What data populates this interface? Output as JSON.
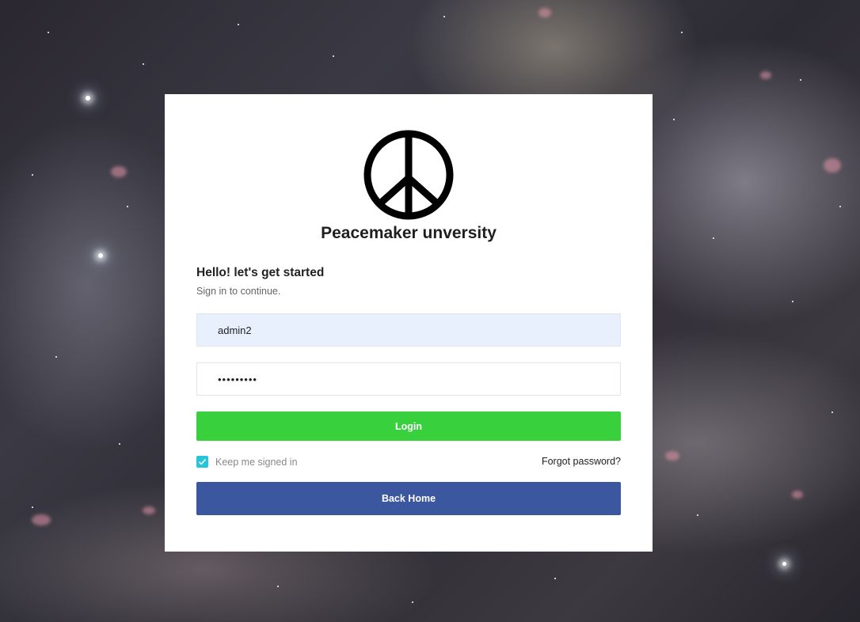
{
  "brand": {
    "name": "Peacemaker unversity",
    "logo_icon": "peace-sign-icon"
  },
  "form": {
    "heading": "Hello! let's get started",
    "subheading": "Sign in to continue.",
    "username_value": "admin2",
    "password_value": "•••••••••",
    "login_label": "Login",
    "keep_signed_in_label": "Keep me signed in",
    "keep_signed_in_checked": true,
    "forgot_password_label": "Forgot password?",
    "back_home_label": "Back Home"
  },
  "colors": {
    "login_button": "#38d13d",
    "back_home_button": "#3a57a0",
    "checkbox": "#26c5db",
    "username_autofill_bg": "#e8f0fe"
  }
}
